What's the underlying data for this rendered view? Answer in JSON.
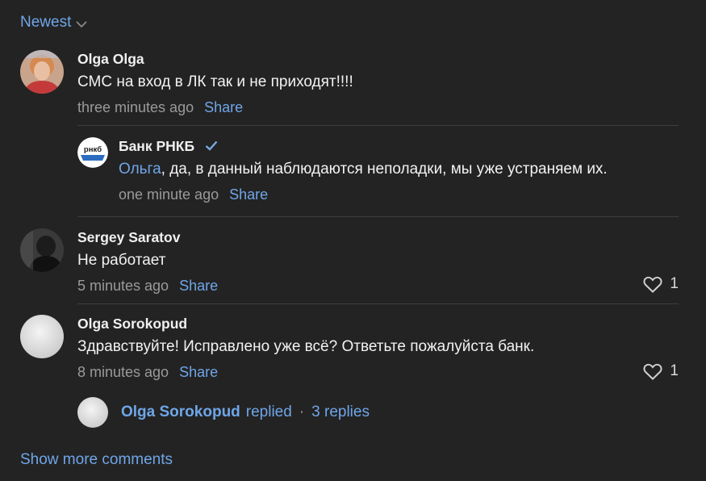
{
  "sort": {
    "label": "Newest",
    "icon": "chevron-down-icon"
  },
  "comments": [
    {
      "author": "Olga Olga",
      "text": "СМС на вход в ЛК так и не приходят!!!!",
      "time": "three minutes ago",
      "share": "Share",
      "reply": {
        "author": "Банк РНКБ",
        "avatar_text": "рнкб",
        "mention": "Ольга",
        "text": ", да, в данный наблюдаются неполадки, мы уже устраняем их.",
        "time": "one minute ago",
        "share": "Share"
      }
    },
    {
      "author": "Sergey Saratov",
      "text": "Не работает",
      "time": "5 minutes ago",
      "share": "Share",
      "likes": "1"
    },
    {
      "author": "Olga Sorokopud",
      "text": "Здравствуйте! Исправлено уже всё? Ответьте пожалуйста банк.",
      "time": "8 minutes ago",
      "share": "Share",
      "likes": "1",
      "replied": {
        "name": "Olga Sorokopud",
        "word": "replied",
        "separator": "·",
        "count": "3 replies"
      }
    }
  ],
  "show_more": "Show more comments",
  "colors": {
    "background": "#232323",
    "accent": "#6fa6e8",
    "muted": "#9a9a9a"
  }
}
